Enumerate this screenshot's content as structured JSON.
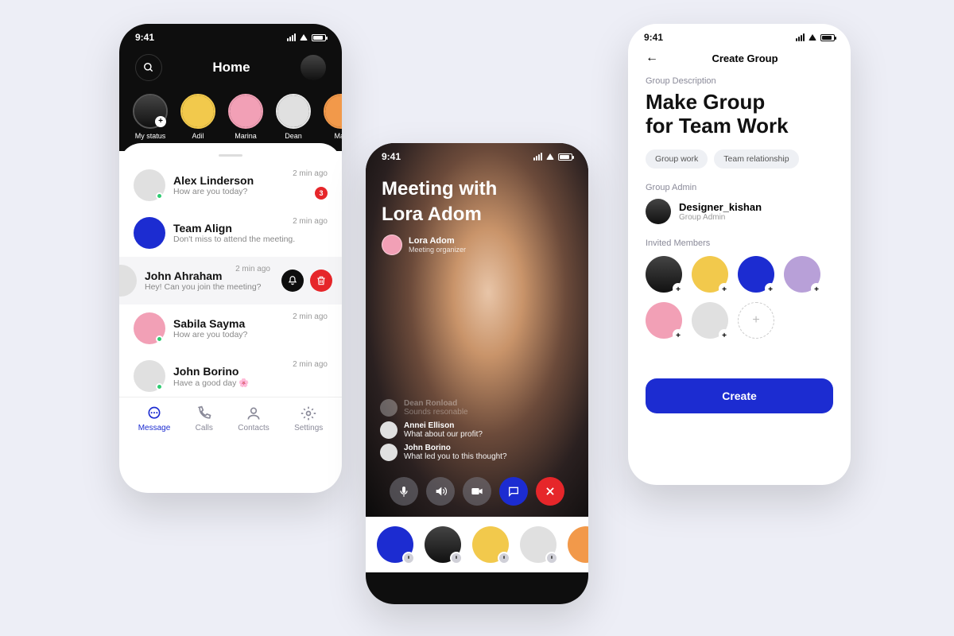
{
  "status_time": "9:41",
  "screen1": {
    "title": "Home",
    "stories": [
      {
        "label": "My status",
        "ring": "#555",
        "color": "c0",
        "own": true
      },
      {
        "label": "Adil",
        "ring": "#f2c94c",
        "color": "c1"
      },
      {
        "label": "Marina",
        "ring": "#f2a0b6",
        "color": "c2"
      },
      {
        "label": "Dean",
        "ring": "#e8e8e8",
        "color": "c3"
      },
      {
        "label": "Max",
        "ring": "#f2994a",
        "color": "c4"
      }
    ],
    "chats": [
      {
        "name": "Alex Linderson",
        "sub": "How are you today?",
        "time": "2 min ago",
        "color": "c3",
        "online": true,
        "badge": "3"
      },
      {
        "name": "Team Align",
        "sub": "Don't miss to attend the meeting.",
        "time": "2 min ago",
        "color": "c5"
      },
      {
        "name": "John Ahraham",
        "sub": "Hey! Can you join the meeting?",
        "time": "2 min ago",
        "color": "c3",
        "swiped": true
      },
      {
        "name": "Sabila Sayma",
        "sub": "How are you today?",
        "time": "2 min ago",
        "color": "c2",
        "online": true
      },
      {
        "name": "John Borino",
        "sub": "Have a good day 🌸",
        "time": "2 min ago",
        "color": "c3",
        "online": true
      }
    ],
    "tabs": [
      {
        "label": "Message",
        "active": true
      },
      {
        "label": "Calls"
      },
      {
        "label": "Contacts"
      },
      {
        "label": "Settings"
      }
    ]
  },
  "screen2": {
    "title_l1": "Meeting with",
    "title_l2": "Lora Adom",
    "organizer": {
      "name": "Lora Adom",
      "role": "Meeting organizer"
    },
    "messages": [
      {
        "name": "Dean Ronload",
        "text": "Sounds resonable",
        "faded": true
      },
      {
        "name": "Annei Ellison",
        "text": "What about our profit?"
      },
      {
        "name": "John Borino",
        "text": "What led you to this thought?"
      }
    ],
    "participants": [
      "c5",
      "c0",
      "c1",
      "c3",
      "c4"
    ]
  },
  "screen3": {
    "header": "Create Group",
    "desc_label": "Group Description",
    "title_l1": "Make Group",
    "title_l2": "for Team Work",
    "chips": [
      "Group work",
      "Team  relationship"
    ],
    "admin_label": "Group Admin",
    "admin": {
      "name": "Designer_kishan",
      "role": "Group Admin"
    },
    "members_label": "Invited Members",
    "members": [
      "c0",
      "c1",
      "c5",
      "c6",
      "c2",
      "c3"
    ],
    "create_label": "Create"
  }
}
